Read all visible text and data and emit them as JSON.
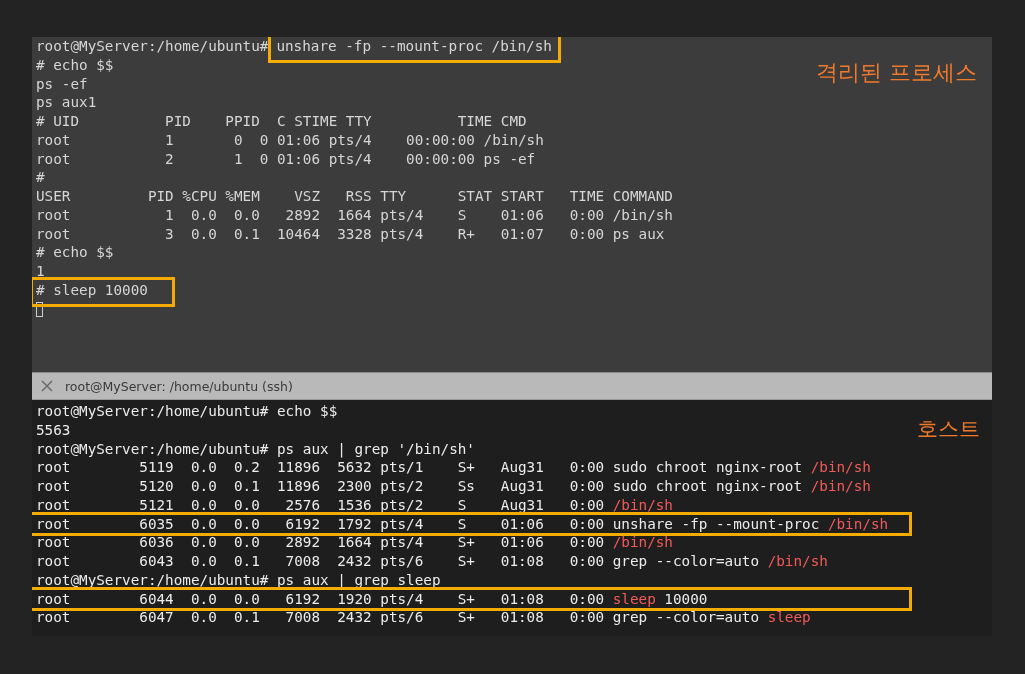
{
  "isolated_terminal": {
    "label": "격리된 프로세스",
    "lines": [
      {
        "parts": [
          {
            "text": "root@MyServer:/home/ubuntu#",
            "boxed": false
          },
          {
            "text": "unshare -fp --mount-proc /bin/sh",
            "boxed": true
          }
        ]
      },
      {
        "text": "# echo $$",
        "boxed": false
      },
      {
        "text": "ps -ef",
        "boxed": false
      },
      {
        "text": "ps aux1",
        "boxed": false
      },
      {
        "text": "# UID          PID    PPID  C STIME TTY          TIME CMD",
        "boxed": false
      },
      {
        "text": "root           1       0  0 01:06 pts/4    00:00:00 /bin/sh",
        "boxed": false
      },
      {
        "text": "root           2       1  0 01:06 pts/4    00:00:00 ps -ef",
        "boxed": false
      },
      {
        "text": "#",
        "boxed": false
      },
      {
        "text": "USER         PID %CPU %MEM    VSZ   RSS TTY      STAT START   TIME COMMAND",
        "boxed": false
      },
      {
        "text": "root           1  0.0  0.0   2892  1664 pts/4    S    01:06   0:00 /bin/sh",
        "boxed": false
      },
      {
        "text": "root           3  0.0  0.1  10464  3328 pts/4    R+   01:07   0:00 ps aux",
        "boxed": false
      },
      {
        "text": "# echo $$",
        "boxed": false
      },
      {
        "text": "1",
        "boxed": false
      },
      {
        "text": "# sleep 10000",
        "boxed": true
      }
    ]
  },
  "tab": {
    "title": "root@MyServer: /home/ubuntu (ssh)"
  },
  "host_terminal": {
    "label": "호스트",
    "lines": [
      {
        "boxed": false,
        "parts": [
          {
            "text": "root@MyServer:/home/ubuntu# echo $$",
            "match": false
          }
        ]
      },
      {
        "boxed": false,
        "parts": [
          {
            "text": "5563",
            "match": false
          }
        ]
      },
      {
        "boxed": false,
        "parts": [
          {
            "text": "root@MyServer:/home/ubuntu# ps aux | grep '/bin/sh'",
            "match": false
          }
        ]
      },
      {
        "boxed": false,
        "parts": [
          {
            "text": "root        5119  0.0  0.2  11896  5632 pts/1    S+   Aug31   0:00 sudo chroot nginx-root ",
            "match": false
          },
          {
            "text": "/bin/sh",
            "match": true
          }
        ]
      },
      {
        "boxed": false,
        "parts": [
          {
            "text": "root        5120  0.0  0.1  11896  2300 pts/2    Ss   Aug31   0:00 sudo chroot nginx-root ",
            "match": false
          },
          {
            "text": "/bin/sh",
            "match": true
          }
        ]
      },
      {
        "boxed": false,
        "parts": [
          {
            "text": "root        5121  0.0  0.0   2576  1536 pts/2    S    Aug31   0:00 ",
            "match": false
          },
          {
            "text": "/bin/sh",
            "match": true
          }
        ]
      },
      {
        "boxed": true,
        "parts": [
          {
            "text": "root        6035  0.0  0.0   6192  1792 pts/4    S    01:06   0:00 unshare -fp --mount-proc ",
            "match": false
          },
          {
            "text": "/bin/sh",
            "match": true
          }
        ]
      },
      {
        "boxed": false,
        "parts": [
          {
            "text": "root        6036  0.0  0.0   2892  1664 pts/4    S+   01:06   0:00 ",
            "match": false
          },
          {
            "text": "/bin/sh",
            "match": true
          }
        ]
      },
      {
        "boxed": false,
        "parts": [
          {
            "text": "root        6043  0.0  0.1   7008  2432 pts/6    S+   01:08   0:00 grep --color=auto ",
            "match": false
          },
          {
            "text": "/bin/sh",
            "match": true
          }
        ]
      },
      {
        "boxed": false,
        "parts": [
          {
            "text": "root@MyServer:/home/ubuntu# ps aux | grep sleep",
            "match": false
          }
        ]
      },
      {
        "boxed": true,
        "parts": [
          {
            "text": "root        6044  0.0  0.0   6192  1920 pts/4    S+   01:08   0:00 ",
            "match": false
          },
          {
            "text": "sleep",
            "match": true
          },
          {
            "text": " 10000",
            "match": false
          }
        ]
      },
      {
        "boxed": false,
        "parts": [
          {
            "text": "root        6047  0.0  0.1   7008  2432 pts/6    S+   01:08   0:00 grep --color=auto ",
            "match": false
          },
          {
            "text": "sleep",
            "match": true
          }
        ]
      }
    ]
  }
}
